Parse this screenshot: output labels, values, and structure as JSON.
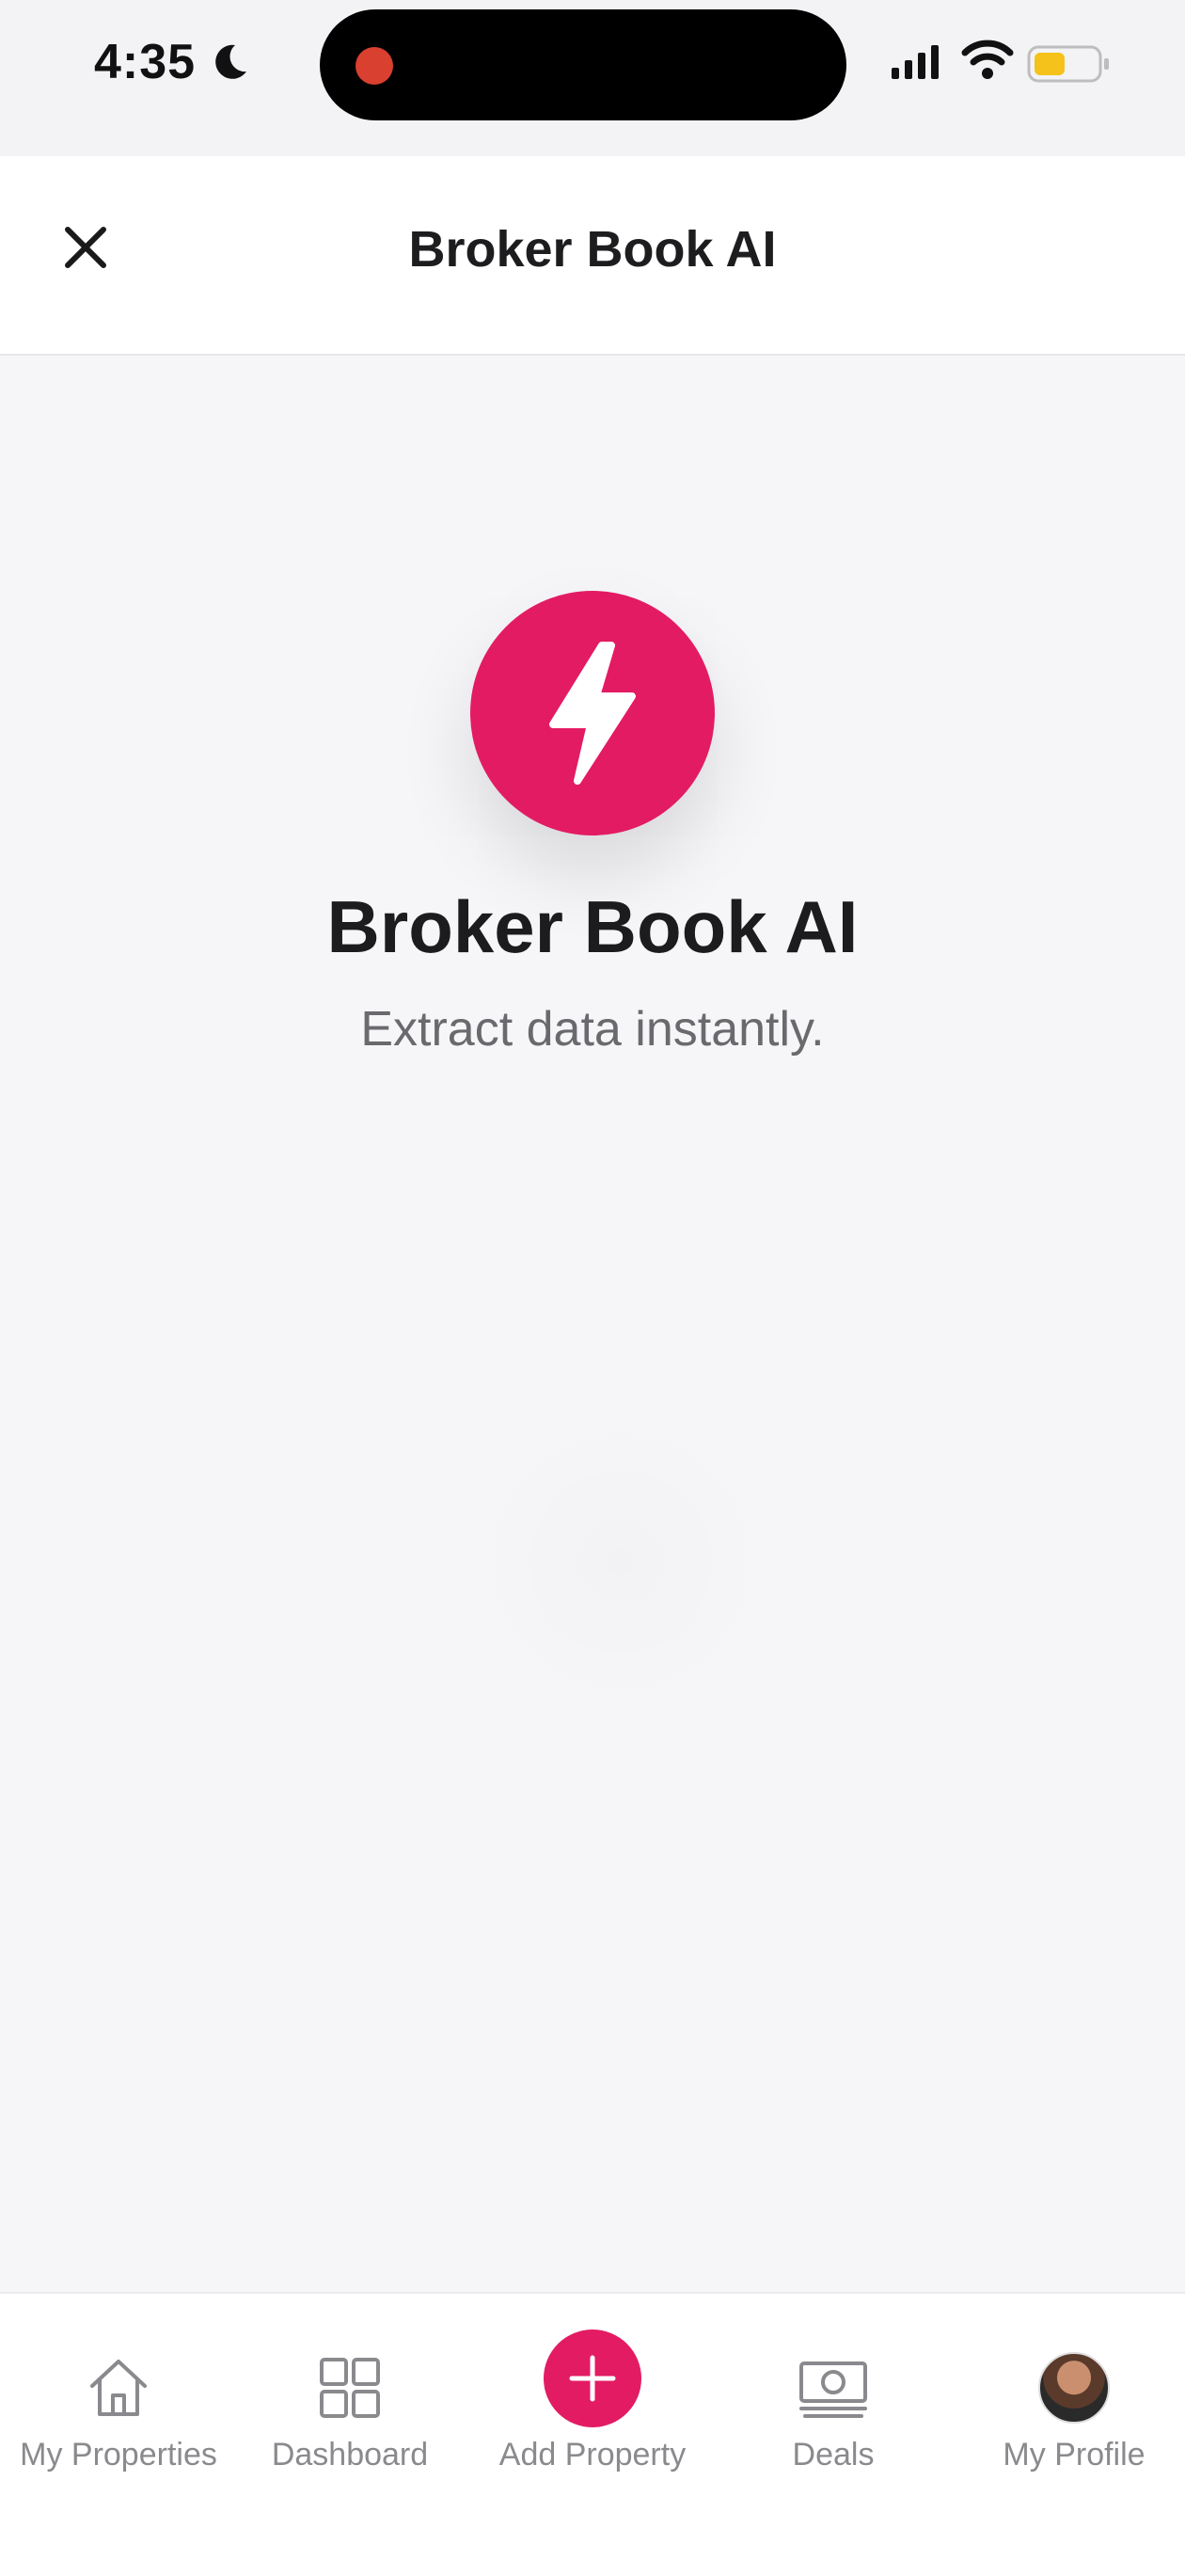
{
  "status_bar": {
    "time": "4:35",
    "icons": [
      "moon-icon",
      "recording-dot",
      "signal-icon",
      "wifi-icon",
      "battery-icon"
    ]
  },
  "header": {
    "title": "Broker Book AI",
    "close_icon": "close-icon"
  },
  "hero": {
    "icon": "lightning-bolt-icon",
    "title": "Broker Book AI",
    "subtitle": "Extract data instantly."
  },
  "tabbar": {
    "items": [
      {
        "label": "My Properties",
        "icon": "home-icon"
      },
      {
        "label": "Dashboard",
        "icon": "grid-icon"
      },
      {
        "label": "Add Property",
        "icon": "plus-icon"
      },
      {
        "label": "Deals",
        "icon": "money-icon"
      },
      {
        "label": "My Profile",
        "icon": "avatar"
      }
    ]
  },
  "colors": {
    "accent": "#e31b63",
    "background": "#f6f6f8",
    "text": "#1c1c1e",
    "muted": "#8a8a8e"
  }
}
